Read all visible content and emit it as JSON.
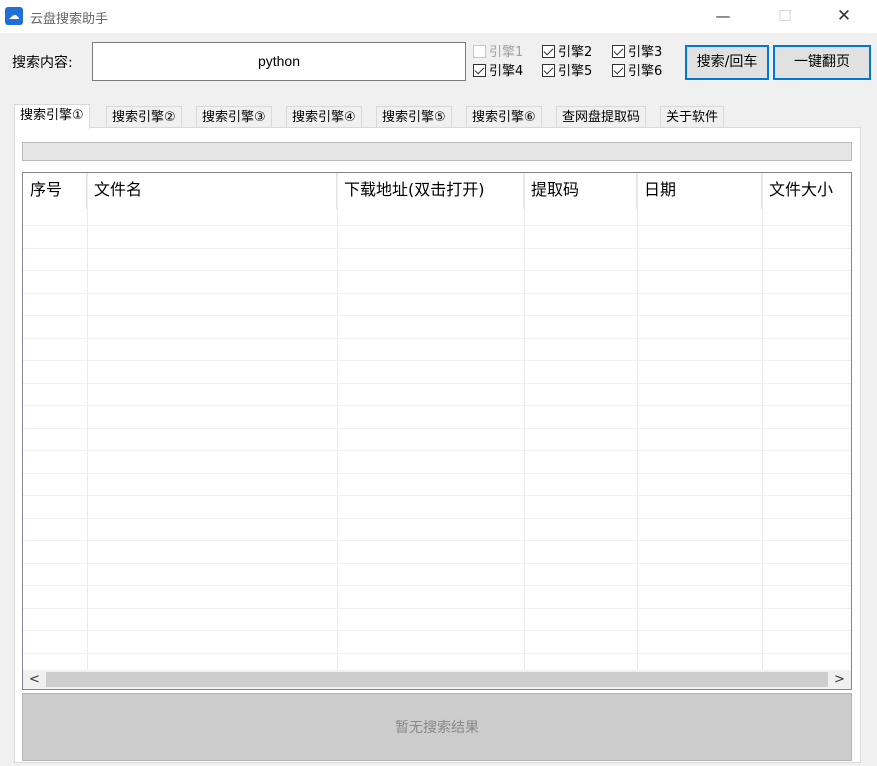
{
  "window": {
    "title": "云盘搜索助手",
    "icon": "cloud-disk-app-icon",
    "controls": {
      "minimize": "—",
      "maximize": "☐",
      "close": "✕"
    }
  },
  "search": {
    "label": "搜索内容:",
    "value": "python"
  },
  "engines": [
    {
      "label": "引擎1",
      "checked": false,
      "enabled": false
    },
    {
      "label": "引擎2",
      "checked": true,
      "enabled": true
    },
    {
      "label": "引擎3",
      "checked": true,
      "enabled": true
    },
    {
      "label": "引擎4",
      "checked": true,
      "enabled": true
    },
    {
      "label": "引擎5",
      "checked": true,
      "enabled": true
    },
    {
      "label": "引擎6",
      "checked": true,
      "enabled": true
    }
  ],
  "buttons": {
    "search": "搜索/回车",
    "page": "一键翻页"
  },
  "tabs": [
    {
      "label": "搜索引擎①",
      "active": true
    },
    {
      "label": "搜索引擎②",
      "active": false
    },
    {
      "label": "搜索引擎③",
      "active": false
    },
    {
      "label": "搜索引擎④",
      "active": false
    },
    {
      "label": "搜索引擎⑤",
      "active": false
    },
    {
      "label": "搜索引擎⑥",
      "active": false
    },
    {
      "label": "查网盘提取码",
      "active": false
    },
    {
      "label": "关于软件",
      "active": false
    }
  ],
  "progress": 0,
  "table": {
    "columns": [
      "序号",
      "文件名",
      "下载地址(双击打开)",
      "提取码",
      "日期",
      "文件大小"
    ],
    "rows": []
  },
  "scrollbar": {
    "left_arrow": "<",
    "right_arrow": ">"
  },
  "status": "暂无搜索结果"
}
